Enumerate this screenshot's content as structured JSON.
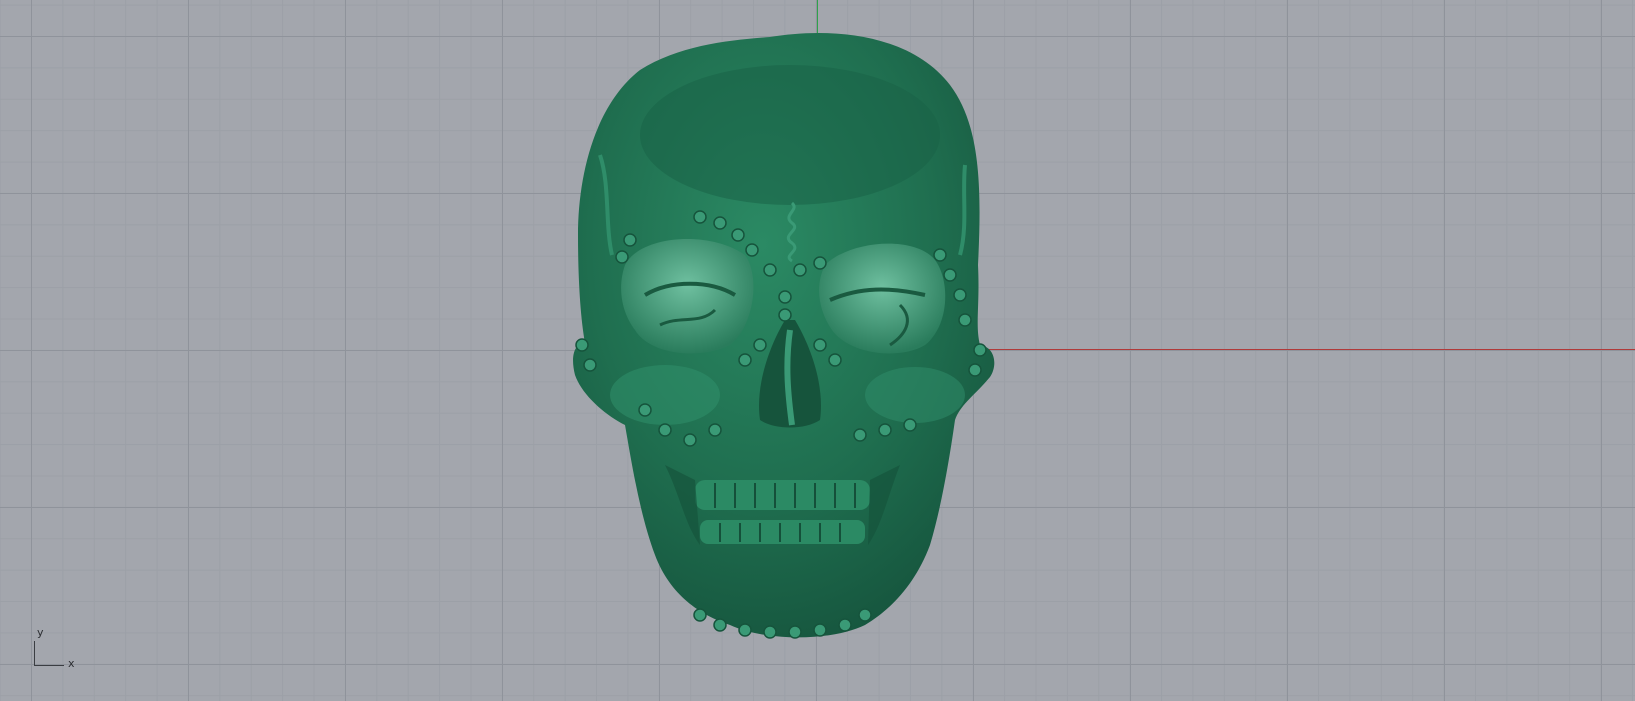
{
  "viewport": {
    "grid": true,
    "background_color": "#a3a6ad",
    "x_axis_color": "#b03a3a",
    "y_axis_color": "#2ea24a"
  },
  "model": {
    "name": "skull",
    "color": "#1f6e4f",
    "highlight": "#4ea88a"
  },
  "axis_widget": {
    "y_label": "y",
    "x_label": "x"
  }
}
